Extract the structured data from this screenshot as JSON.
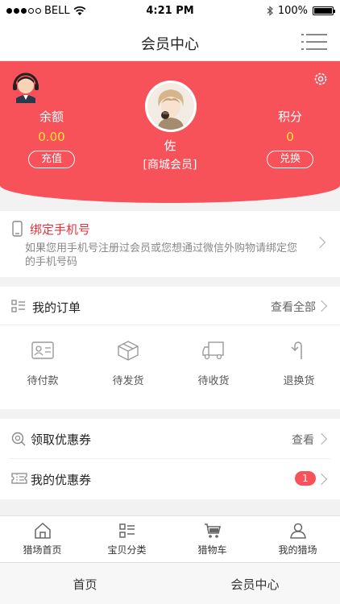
{
  "status_bar": {
    "carrier": "BELL",
    "time": "4:21 PM",
    "battery": "100%"
  },
  "nav": {
    "title": "会员中心"
  },
  "header": {
    "balance_label": "余额",
    "balance_value": "0.00",
    "balance_button": "充值",
    "points_label": "积分",
    "points_value": "0",
    "points_button": "兑换",
    "username": "佐",
    "member_level": "[商城会员]"
  },
  "bind_phone": {
    "title": "绑定手机号",
    "description": "如果您用手机号注册过会员或您想通过微信外购物请绑定您的手机号码"
  },
  "orders": {
    "title": "我的订单",
    "view_all": "查看全部",
    "statuses": [
      {
        "label": "待付款",
        "icon": "card-icon"
      },
      {
        "label": "待发货",
        "icon": "box-icon"
      },
      {
        "label": "待收货",
        "icon": "truck-icon"
      },
      {
        "label": "退换货",
        "icon": "return-icon"
      }
    ]
  },
  "coupons": {
    "get_title": "领取优惠券",
    "get_action": "查看",
    "mine_title": "我的优惠券",
    "mine_count": "1"
  },
  "tabbar": [
    {
      "label": "猎场首页",
      "icon": "home-icon"
    },
    {
      "label": "宝贝分类",
      "icon": "category-icon"
    },
    {
      "label": "猎物车",
      "icon": "cart-icon"
    },
    {
      "label": "我的猎场",
      "icon": "user-icon"
    }
  ],
  "bottom_bar": {
    "left": "首页",
    "right": "会员中心"
  },
  "colors": {
    "accent": "#f7525a",
    "value_yellow": "#ffe13a",
    "link_red": "#e0333c"
  }
}
